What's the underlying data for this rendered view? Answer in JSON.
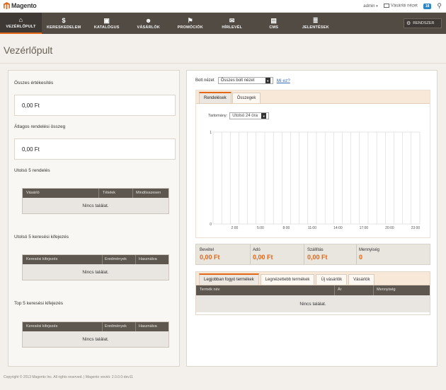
{
  "topbar": {
    "logo_text": "Magento",
    "user": "admin",
    "store_view_link": "Vásárlói nézet",
    "notification_count": "18"
  },
  "nav": {
    "items": [
      {
        "label": "VEZÉRLŐPULT",
        "icon": "home-icon",
        "glyph": "⌂"
      },
      {
        "label": "KERESKEDELEM",
        "icon": "cash-icon",
        "glyph": "$"
      },
      {
        "label": "KATALÓGUS",
        "icon": "catalog-icon",
        "glyph": "▣"
      },
      {
        "label": "VÁSÁRLÓK",
        "icon": "customers-icon",
        "glyph": "☻"
      },
      {
        "label": "PROMÓCIÓK",
        "icon": "flag-icon",
        "glyph": "⚑"
      },
      {
        "label": "HÍRLEVÉL",
        "icon": "mail-icon",
        "glyph": "✉"
      },
      {
        "label": "CMS",
        "icon": "document-icon",
        "glyph": "▤"
      },
      {
        "label": "JELENTÉSEK",
        "icon": "reports-icon",
        "glyph": "≣"
      }
    ],
    "system_label": "RENDSZER"
  },
  "page": {
    "title": "Vezérlőpult"
  },
  "left": {
    "total_sales_label": "Összes értékesítés",
    "total_sales_value": "0,00 Ft",
    "avg_order_label": "Átlagos rendelési összeg",
    "avg_order_value": "0,00 Ft",
    "last_orders_label": "Utolsó 5 rendelés",
    "last_orders_headers": [
      "Vásárló",
      "Tételek",
      "Mindösszesen"
    ],
    "last_orders_empty": "Nincs találat.",
    "last_searches_label": "Utolsó 5 keresési kifejezés",
    "last_searches_headers": [
      "Keresési kifejezés",
      "Eredmények",
      "Használva"
    ],
    "last_searches_empty": "Nincs találat.",
    "top_searches_label": "Top 5 keresési kifejezés",
    "top_searches_headers": [
      "Keresési kifejezés",
      "Eredmények",
      "Használva"
    ],
    "top_searches_empty": "Nincs találat."
  },
  "right": {
    "store_view_label": "Bolt nézet",
    "store_view_value": "Összes bolt nézet",
    "what_is_this": "Mi ez?",
    "tabs": [
      "Rendelések",
      "Összegek"
    ],
    "range_label": "Tartomány:",
    "range_value": "Utolsó 24 óra",
    "totals": [
      {
        "label": "Bevétel",
        "value": "0,00 Ft"
      },
      {
        "label": "Adó",
        "value": "0,00 Ft"
      },
      {
        "label": "Szállítás",
        "value": "0,00 Ft"
      },
      {
        "label": "Mennyiség",
        "value": "0"
      }
    ],
    "product_tabs": [
      "Legjobban fogyó termékek",
      "Legnézettebb termékek",
      "Új vásárlók",
      "Vásárlók"
    ],
    "product_headers": [
      "Termék név",
      "Ár",
      "Mennyiség"
    ],
    "product_empty": "Nincs találat."
  },
  "chart_data": {
    "type": "bar",
    "categories": [
      "2:00",
      "5:00",
      "8:00",
      "11:00",
      "14:00",
      "17:00",
      "20:00",
      "23:00"
    ],
    "values": [
      0,
      0,
      0,
      0,
      0,
      0,
      0,
      0
    ],
    "title": "",
    "xlabel": "",
    "ylabel": "",
    "ylim": [
      0,
      1
    ],
    "y_ticks": [
      "0",
      "1"
    ],
    "grid": true
  },
  "footer": {
    "text": "Copyright © 2013 Magento Inc. All rights reserved. | Magento verzió: 2.0.0.0-dev11"
  }
}
